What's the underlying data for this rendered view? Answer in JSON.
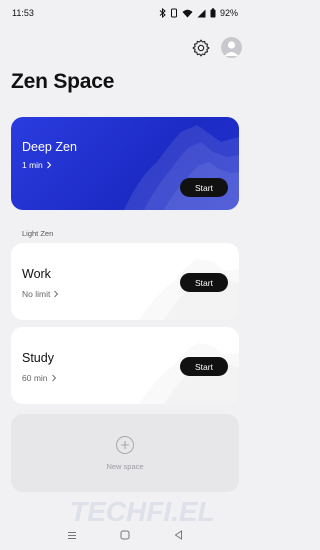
{
  "status_bar": {
    "time": "11:53",
    "battery": "92%"
  },
  "header": {
    "title": "Zen Space"
  },
  "deep_zen": {
    "title": "Deep Zen",
    "duration": "1 min",
    "start_label": "Start"
  },
  "section": {
    "label": "Light Zen"
  },
  "light_zen": [
    {
      "title": "Work",
      "duration": "No limit",
      "start_label": "Start"
    },
    {
      "title": "Study",
      "duration": "60 min",
      "start_label": "Start"
    }
  ],
  "new_space": {
    "label": "New space"
  },
  "icons": {
    "settings": "gear-icon",
    "profile": "avatar",
    "add": "plus-icon",
    "nav_menu": "menu-icon",
    "nav_home": "home-icon",
    "nav_back": "back-icon"
  },
  "colors": {
    "deep_card": "#2232d0",
    "background": "#f1f1f3",
    "button": "#111111"
  }
}
